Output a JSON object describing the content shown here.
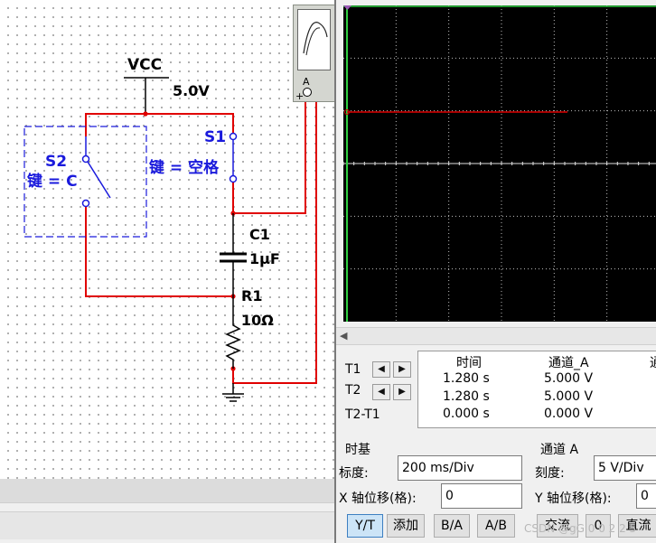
{
  "circuit": {
    "vcc_label": "VCC",
    "vcc_value": "5.0V",
    "s1_label": "S1",
    "s1_key": "键 = 空格",
    "s2_label": "S2",
    "s2_key": "键 = C",
    "c1_label": "C1",
    "c1_value": "1µF",
    "r1_label": "R1",
    "r1_value": "10Ω",
    "scope_terminal_label": "A",
    "scope_plus": "+",
    "wire_color": "#e00000",
    "component_color": "#1a1adc"
  },
  "oscilloscope": {
    "trace_color": "#e00000",
    "grid": true,
    "background": "#000000",
    "readout": {
      "headers": [
        "时间",
        "通道_A",
        "通"
      ],
      "rows": [
        {
          "label": "T1",
          "time": "1.280 s",
          "channel_a": "5.000 V"
        },
        {
          "label": "T2",
          "time": "1.280 s",
          "channel_a": "5.000 V"
        },
        {
          "label": "T2-T1",
          "time": "0.000 s",
          "channel_a": "0.000 V"
        }
      ]
    },
    "timebase": {
      "title": "时基",
      "scale_label": "标度:",
      "scale_value": "200 ms/Div",
      "xpos_label": "X 轴位移(格):",
      "xpos_value": "0",
      "buttons": [
        "Y/T",
        "添加",
        "B/A",
        "A/B"
      ]
    },
    "channel_a": {
      "title": "通道 A",
      "scale_label": "刻度:",
      "scale_value": "5  V/Div",
      "ypos_label": "Y 轴位移(格):",
      "ypos_value": "0",
      "buttons": [
        "交流",
        "0",
        "直流"
      ]
    }
  },
  "watermark": "CSDN @gG 0 0 2 2 5"
}
